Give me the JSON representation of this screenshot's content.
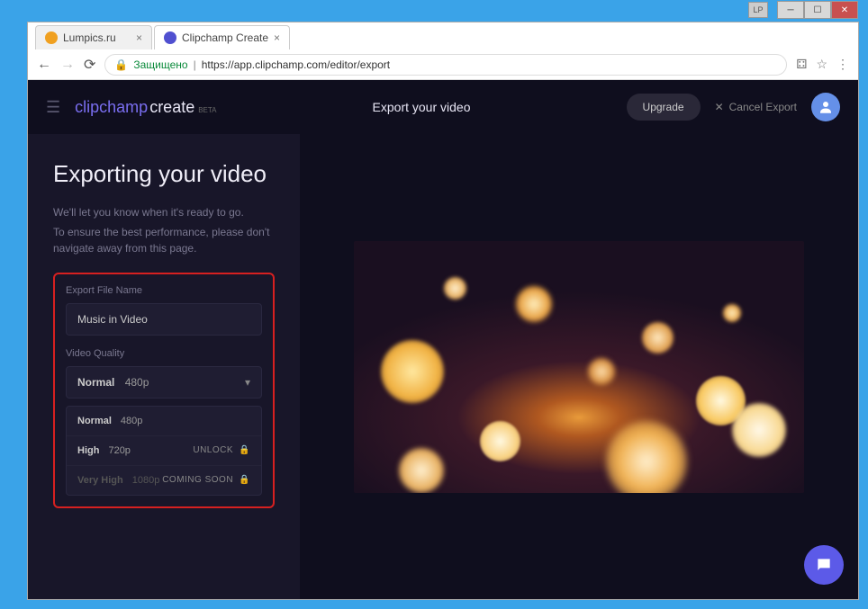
{
  "window": {
    "lp_badge": "LP"
  },
  "tabs": [
    {
      "title": "Lumpics.ru",
      "icon_color": "#f0a020"
    },
    {
      "title": "Clipchamp Create",
      "icon_color": "#5050d0"
    }
  ],
  "addressbar": {
    "secure_label": "Защищено",
    "url": "https://app.clipchamp.com/editor/export"
  },
  "header": {
    "logo_clip": "clipchamp",
    "logo_create": "create",
    "logo_beta": "BETA",
    "title": "Export your video",
    "upgrade": "Upgrade",
    "cancel": "Cancel Export"
  },
  "panel": {
    "title": "Exporting your video",
    "desc1": "We'll let you know when it's ready to go.",
    "desc2": "To ensure the best performance, please don't navigate away from this page.",
    "file_name_label": "Export File Name",
    "file_name_value": "Music in Video",
    "quality_label": "Video Quality",
    "selected_quality": "Normal",
    "selected_res": "480p"
  },
  "quality_options": [
    {
      "label": "Normal",
      "res": "480p",
      "right": "",
      "dim": false
    },
    {
      "label": "High",
      "res": "720p",
      "right": "UNLOCK",
      "dim": false,
      "lock": true
    },
    {
      "label": "Very High",
      "res": "1080p",
      "right": "COMING SOON",
      "dim": true,
      "lock": true
    }
  ]
}
